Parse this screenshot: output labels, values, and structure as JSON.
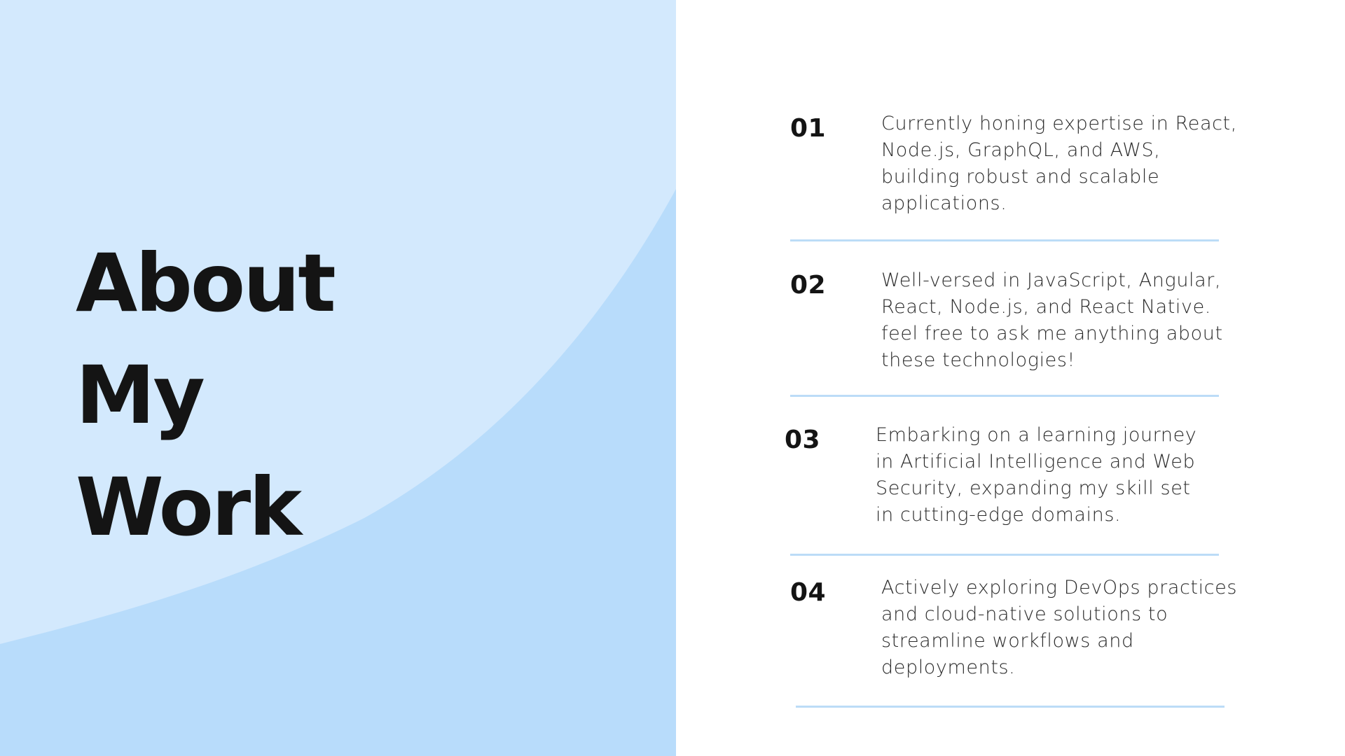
{
  "title": {
    "line1": "About",
    "line2": "My",
    "line3": "Work"
  },
  "items": [
    {
      "number": "01",
      "text": "Currently honing expertise in React,\nNode.js, GraphQL, and AWS,\nbuilding robust and scalable\napplications."
    },
    {
      "number": "02",
      "text": "Well-versed in JavaScript, Angular,\nReact, Node.js, and React Native.\nfeel free to ask me anything about\nthese technologies!"
    },
    {
      "number": "03",
      "text": "Embarking on a learning journey\nin Artificial Intelligence and Web\nSecurity, expanding my skill set\nin cutting-edge domains."
    },
    {
      "number": "04",
      "text": "Actively exploring DevOps practices\nand cloud-native solutions to\nstreamline workflows and\ndeployments."
    }
  ],
  "colors": {
    "panel_light": "#d3e9fd",
    "panel_dark": "#b8dcfb",
    "divider": "#bcdcf7",
    "text": "#141414"
  }
}
